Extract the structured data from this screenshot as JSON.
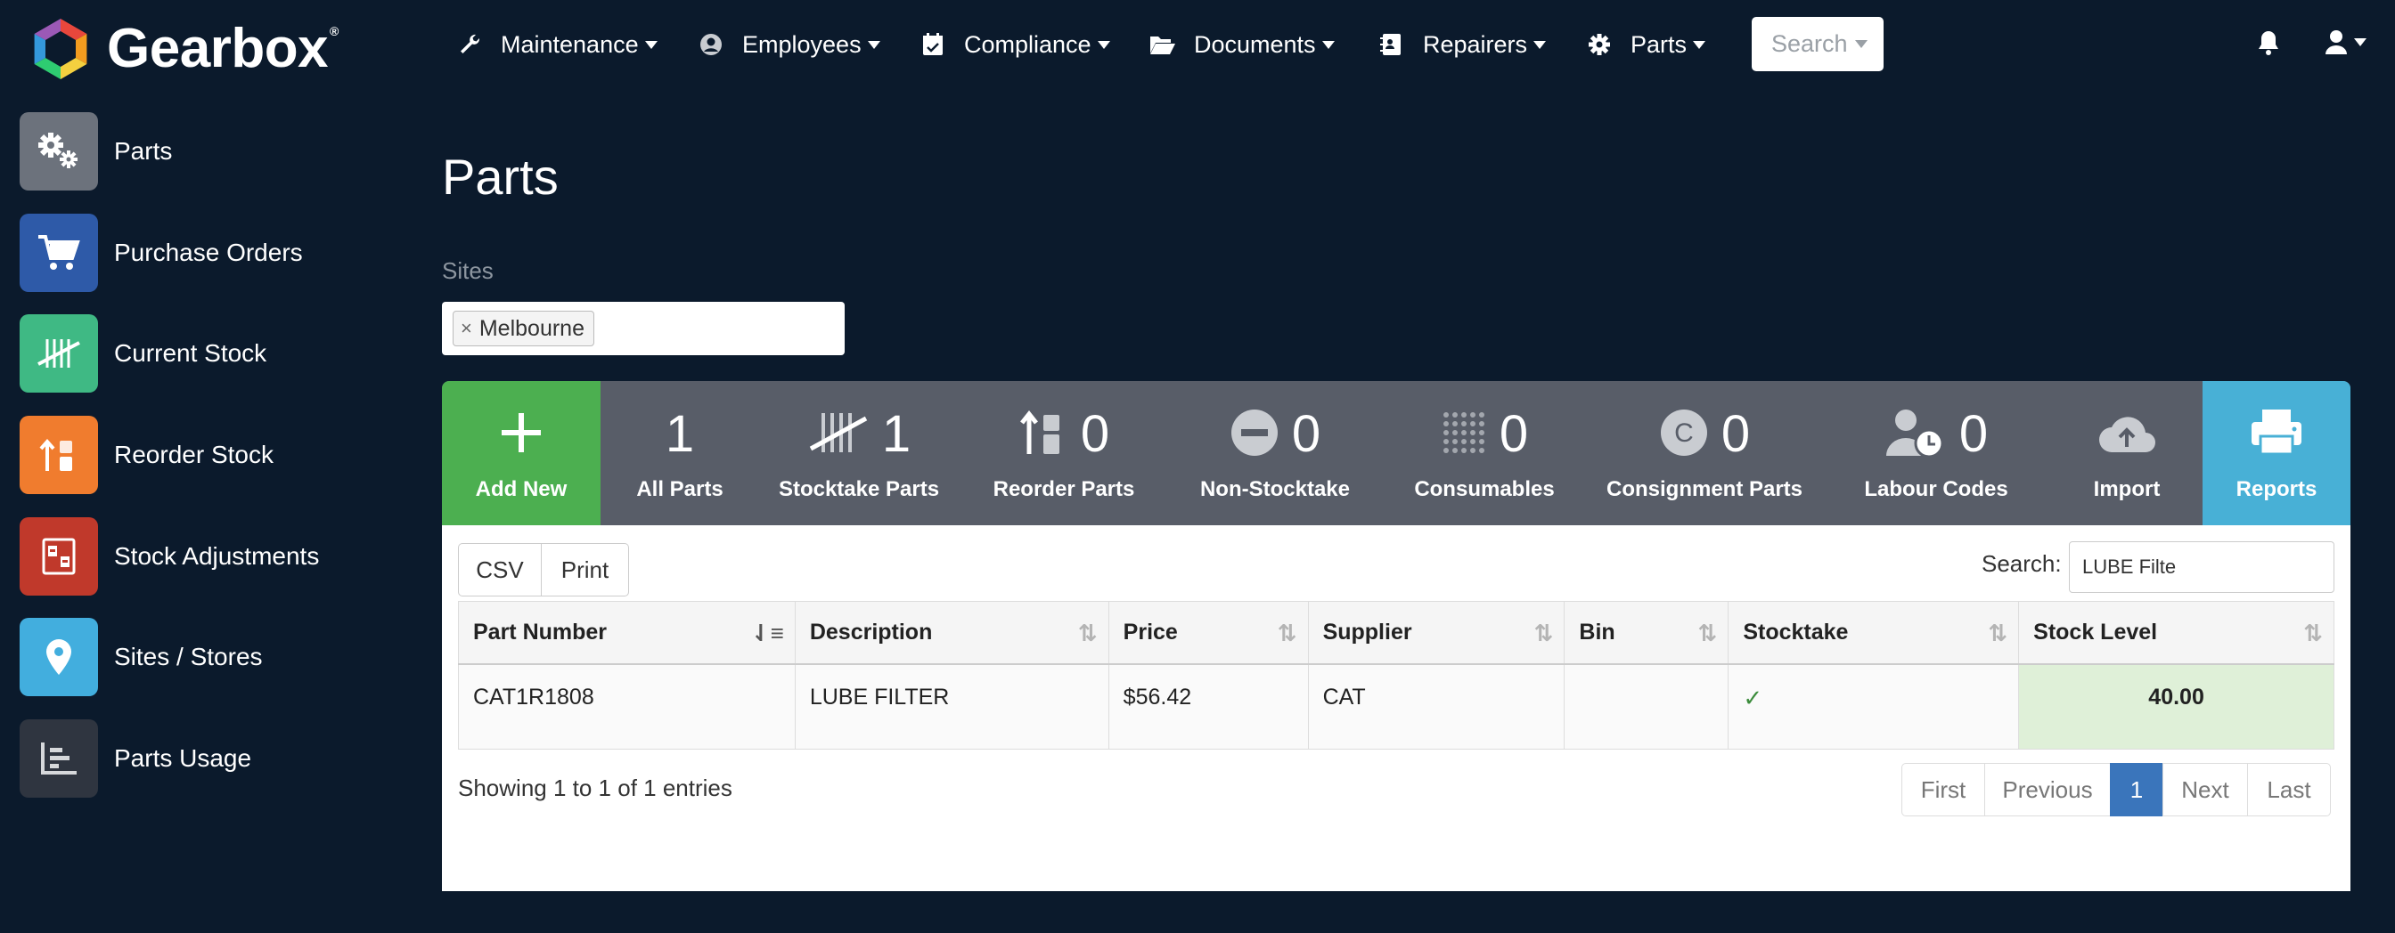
{
  "brand": {
    "name": "Gearbox",
    "tm": "®"
  },
  "nav": {
    "items": [
      {
        "label": "Maintenance",
        "icon": "wrench-icon"
      },
      {
        "label": "Employees",
        "icon": "user-circle-icon"
      },
      {
        "label": "Compliance",
        "icon": "calendar-check-icon"
      },
      {
        "label": "Documents",
        "icon": "folder-open-icon"
      },
      {
        "label": "Repairers",
        "icon": "contact-card-icon"
      },
      {
        "label": "Parts",
        "icon": "gear-icon"
      }
    ],
    "search_label": "Search"
  },
  "sidebar": {
    "items": [
      {
        "label": "Parts",
        "icon": "gears-icon",
        "color": "#6c727c"
      },
      {
        "label": "Purchase Orders",
        "icon": "cart-icon",
        "color": "#2e5aa8"
      },
      {
        "label": "Current Stock",
        "icon": "tally-icon",
        "color": "#3fb984"
      },
      {
        "label": "Reorder Stock",
        "icon": "reorder-icon",
        "color": "#f07c2e"
      },
      {
        "label": "Stock Adjustments",
        "icon": "adjust-icon",
        "color": "#c0392b"
      },
      {
        "label": "Sites / Stores",
        "icon": "map-pin-icon",
        "color": "#42aede"
      },
      {
        "label": "Parts Usage",
        "icon": "bar-chart-icon",
        "color": "#2f3540"
      }
    ]
  },
  "main": {
    "title": "Parts",
    "sites_label": "Sites",
    "selected_site": "Melbourne",
    "tiles": [
      {
        "label": "Add New"
      },
      {
        "label": "All Parts",
        "count": "1"
      },
      {
        "label": "Stocktake Parts",
        "count": "1"
      },
      {
        "label": "Reorder Parts",
        "count": "0"
      },
      {
        "label": "Non-Stocktake",
        "count": "0"
      },
      {
        "label": "Consumables",
        "count": "0"
      },
      {
        "label": "Consignment Parts",
        "count": "0"
      },
      {
        "label": "Labour Codes",
        "count": "0"
      },
      {
        "label": "Import"
      },
      {
        "label": "Reports"
      }
    ]
  },
  "table": {
    "csv_label": "CSV",
    "print_label": "Print",
    "search_label": "Search:",
    "search_value": "LUBE Filte",
    "columns": [
      "Part Number",
      "Description",
      "Price",
      "Supplier",
      "Bin",
      "Stocktake",
      "Stock Level"
    ],
    "rows": [
      {
        "part_number": "CAT1R1808",
        "description": "LUBE FILTER",
        "price": "$56.42",
        "supplier": "CAT",
        "bin": "",
        "stocktake": "✓",
        "stock_level": "40.00"
      }
    ],
    "info": "Showing 1 to 1 of 1 entries",
    "pager": {
      "first": "First",
      "previous": "Previous",
      "current": "1",
      "next": "Next",
      "last": "Last"
    }
  }
}
